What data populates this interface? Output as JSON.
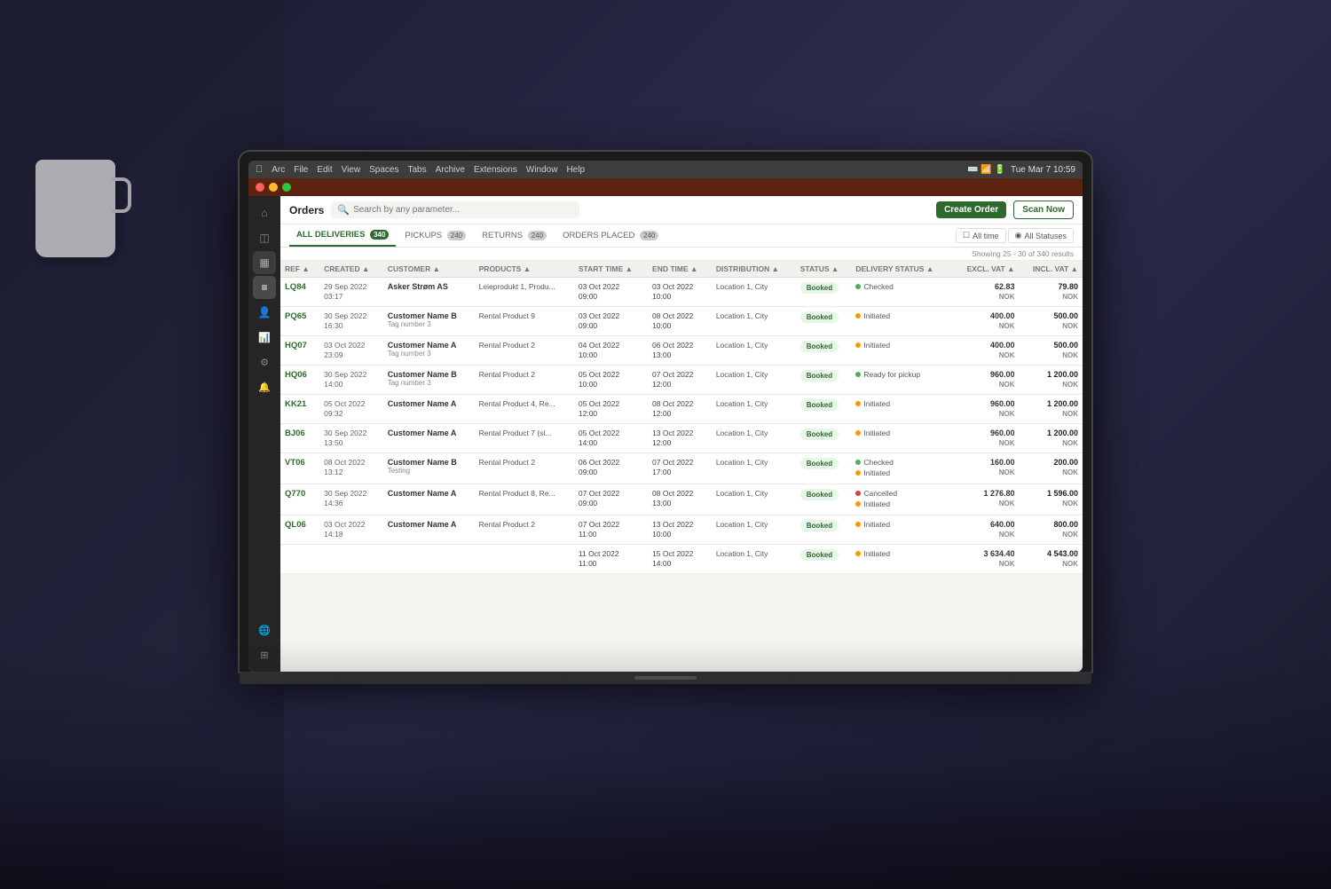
{
  "macos": {
    "left_items": [
      "Arc",
      "File",
      "Edit",
      "View",
      "Spaces",
      "Tabs",
      "Archive",
      "Extensions",
      "Window",
      "Help"
    ],
    "right_time": "Tue Mar 7  10:59"
  },
  "app_menu": [
    "Arc",
    "File",
    "Edit",
    "View",
    "Spaces",
    "Tabs",
    "Archive",
    "Extensions",
    "Window",
    "Help"
  ],
  "toolbar": {
    "title": "Orders",
    "search_placeholder": "Search by any parameter...",
    "create_order": "Create Order",
    "scan_now": "Scan Now"
  },
  "tabs": [
    {
      "label": "ALL DELIVERIES",
      "count": "340",
      "active": true
    },
    {
      "label": "PICKUPS",
      "count": "240"
    },
    {
      "label": "RETURNS",
      "count": "240"
    },
    {
      "label": "ORDERS PLACED",
      "count": "240"
    }
  ],
  "filters": {
    "date_range": "All time",
    "status": "All Statuses"
  },
  "results_info": "Showing 25 - 30 of 340 results",
  "columns": [
    "REF",
    "CREATED",
    "CUSTOMER",
    "PRODUCTS",
    "START TIME",
    "END TIME",
    "DISTRIBUTION",
    "STATUS",
    "DELIVERY STATUS",
    "EXCL. VAT",
    "INCL. VAT"
  ],
  "orders": [
    {
      "ref": "LQ84",
      "created": "29 Sep 2022\n03:17",
      "customer": "Asker Strøm AS",
      "tag": "",
      "product": "Leieprodukt 1, Produ...",
      "start_time": "03 Oct 2022\n09:00",
      "end_time": "03 Oct 2022\n10:00",
      "distribution": "Location 1, City",
      "status": "Booked",
      "delivery_statuses": [
        {
          "dot": "green",
          "label": "Checked"
        }
      ],
      "excl_vat": "62.83\nNOK",
      "incl_vat": "79.80\nNOK"
    },
    {
      "ref": "PQ65",
      "created": "30 Sep 2022\n16:30",
      "customer": "Customer Name B",
      "tag": "Tag number 3",
      "product": "Rental Product 9",
      "start_time": "03 Oct 2022\n09:00",
      "end_time": "08 Oct 2022\n10:00",
      "distribution": "Location 1, City",
      "status": "Booked",
      "delivery_statuses": [
        {
          "dot": "orange",
          "label": "Initiated"
        }
      ],
      "excl_vat": "400.00\nNOK",
      "incl_vat": "500.00\nNOK"
    },
    {
      "ref": "HQ07",
      "created": "03 Oct 2022\n23:09",
      "customer": "Customer Name A",
      "tag": "Tag number 3",
      "product": "Rental Product 2",
      "start_time": "04 Oct 2022\n10:00",
      "end_time": "06 Oct 2022\n13:00",
      "distribution": "Location 1, City",
      "status": "Booked",
      "delivery_statuses": [
        {
          "dot": "orange",
          "label": "Initiated"
        }
      ],
      "excl_vat": "400.00\nNOK",
      "incl_vat": "500.00\nNOK"
    },
    {
      "ref": "HQ06",
      "created": "30 Sep 2022\n14:00",
      "customer": "Customer Name B",
      "tag": "Tag number 3",
      "product": "Rental Product 2",
      "start_time": "05 Oct 2022\n10:00",
      "end_time": "07 Oct 2022\n12:00",
      "distribution": "Location 1, City",
      "status": "Booked",
      "delivery_statuses": [
        {
          "dot": "green",
          "label": "Ready for pickup"
        }
      ],
      "excl_vat": "960.00\nNOK",
      "incl_vat": "1 200.00\nNOK"
    },
    {
      "ref": "KK21",
      "created": "05 Oct 2022\n09:32",
      "customer": "Customer Name A",
      "tag": "",
      "product": "Rental Product 4, Re...",
      "start_time": "05 Oct 2022\n12:00",
      "end_time": "08 Oct 2022\n12:00",
      "distribution": "Location 1, City",
      "status": "Booked",
      "delivery_statuses": [
        {
          "dot": "orange",
          "label": "Initiated"
        }
      ],
      "excl_vat": "960.00\nNOK",
      "incl_vat": "1 200.00\nNOK"
    },
    {
      "ref": "BJ06",
      "created": "30 Sep 2022\n13:50",
      "customer": "Customer Name A",
      "tag": "",
      "product": "Rental Product 7 (sl...",
      "start_time": "05 Oct 2022\n14:00",
      "end_time": "13 Oct 2022\n12:00",
      "distribution": "Location 1, City",
      "status": "Booked",
      "delivery_statuses": [
        {
          "dot": "orange",
          "label": "Initiated"
        }
      ],
      "excl_vat": "960.00\nNOK",
      "incl_vat": "1 200.00\nNOK"
    },
    {
      "ref": "VT06",
      "created": "08 Oct 2022\n13:12",
      "customer": "Customer Name B",
      "tag": "Testing",
      "product": "Rental Product 2",
      "start_time": "06 Oct 2022\n09:00",
      "end_time": "07 Oct 2022\n17:00",
      "distribution": "Location 1, City",
      "status": "Booked",
      "delivery_statuses": [
        {
          "dot": "green",
          "label": "Checked"
        },
        {
          "dot": "orange",
          "label": "Initiated"
        }
      ],
      "excl_vat": "160.00\nNOK",
      "incl_vat": "200.00\nNOK"
    },
    {
      "ref": "Q770",
      "created": "30 Sep 2022\n14:36",
      "customer": "Customer Name A",
      "tag": "",
      "product": "Rental Product 8, Re...",
      "start_time": "07 Oct 2022\n09:00",
      "end_time": "08 Oct 2022\n13:00",
      "distribution": "Location 1, City",
      "status": "Booked",
      "delivery_statuses": [
        {
          "dot": "red",
          "label": "Cancelled"
        },
        {
          "dot": "orange",
          "label": "Initiated"
        }
      ],
      "excl_vat": "1 276.80\nNOK",
      "incl_vat": "1 596.00\nNOK"
    },
    {
      "ref": "QL06",
      "created": "03 Oct 2022\n14:18",
      "customer": "Customer Name A",
      "tag": "",
      "product": "Rental Product 2",
      "start_time": "07 Oct 2022\n11:00",
      "end_time": "13 Oct 2022\n10:00",
      "distribution": "Location 1, City",
      "status": "Booked",
      "delivery_statuses": [
        {
          "dot": "orange",
          "label": "Initiated"
        }
      ],
      "excl_vat": "640.00\nNOK",
      "incl_vat": "800.00\nNOK"
    },
    {
      "ref": "",
      "created": "",
      "customer": "",
      "tag": "",
      "product": "",
      "start_time": "11 Oct 2022\n11:00",
      "end_time": "15 Oct 2022\n14:00",
      "distribution": "Location 1, City",
      "status": "Booked",
      "delivery_statuses": [
        {
          "dot": "orange",
          "label": "Initiated"
        }
      ],
      "excl_vat": "3 634.40\nNOK",
      "incl_vat": "4 543.00\nNOK"
    }
  ],
  "sidebar_icons": [
    "home",
    "box",
    "calendar",
    "user",
    "settings",
    "chart",
    "globe",
    "bell",
    "grid"
  ]
}
